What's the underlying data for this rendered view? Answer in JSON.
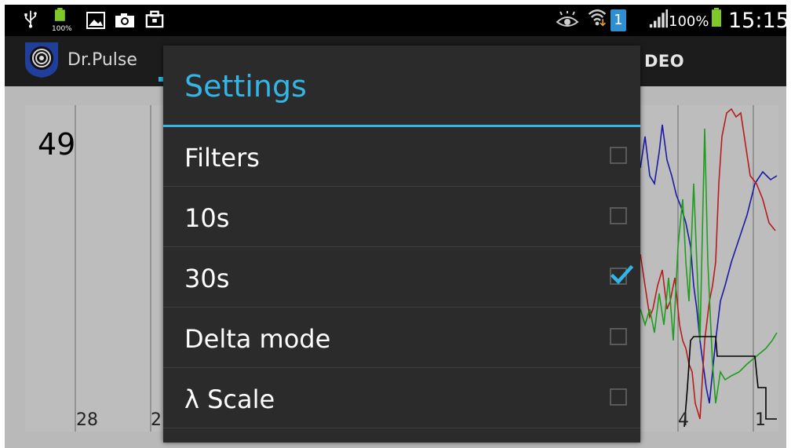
{
  "status_bar": {
    "battery_small_label": "100%",
    "battery_percent": "100%",
    "time": "15:15",
    "notification_badge": "1",
    "icons": [
      "usb-icon",
      "battery-notify-icon",
      "image-icon",
      "camera-icon",
      "briefcase-icon",
      "eye-icon",
      "wifi-icon",
      "signal-icon",
      "battery-icon"
    ]
  },
  "action_bar": {
    "app_title": "Dr.Pulse",
    "partial_tab": "DEO"
  },
  "chart": {
    "pulse_value": "49",
    "x_ticks": [
      "28",
      "2",
      "4",
      "1"
    ]
  },
  "chart_data": {
    "type": "line",
    "series": [
      {
        "color": "#1a1aa6"
      },
      {
        "color": "#b71c1c"
      },
      {
        "color": "#1e9e1e"
      },
      {
        "color": "#000000"
      }
    ]
  },
  "dialog": {
    "title": "Settings",
    "items": [
      {
        "label": "Filters",
        "checked": false
      },
      {
        "label": "10s",
        "checked": false
      },
      {
        "label": "30s",
        "checked": true
      },
      {
        "label": "Delta mode",
        "checked": false
      },
      {
        "label": "λ Scale",
        "checked": false
      }
    ]
  },
  "colors": {
    "accent": "#33b5e5",
    "dialog_bg": "#2b2b2b",
    "chart_bg": "#bdbdbd"
  }
}
